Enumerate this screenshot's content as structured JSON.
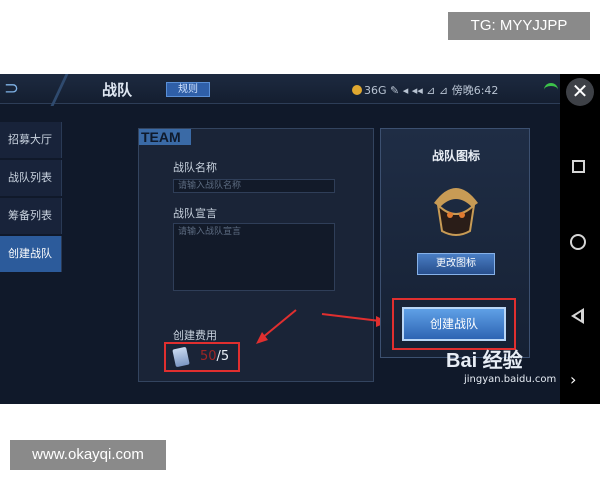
{
  "watermarks": {
    "top": "TG: MYYJJPP",
    "bottom": "www.okayqi.com"
  },
  "header": {
    "title": "战队",
    "tab": "规则",
    "status": "36G ✎ ◂ ◂◂ ⊿ ⊿ 傍晚6:42"
  },
  "sidebar": {
    "items": [
      {
        "label": "招募大厅",
        "active": false
      },
      {
        "label": "战队列表",
        "active": false
      },
      {
        "label": "筹备列表",
        "active": false
      },
      {
        "label": "创建战队",
        "active": true
      }
    ]
  },
  "form": {
    "tag": "TEAM",
    "name_label": "战队名称",
    "name_placeholder": "请输入战队名称",
    "motto_label": "战队宣言",
    "motto_placeholder": "请输入战队宣言",
    "cost_label": "创建费用",
    "cost_have": "50",
    "cost_need": "/5"
  },
  "emblem_panel": {
    "title": "战队图标",
    "change_label": "更改图标"
  },
  "create_button": {
    "label": "创建战队"
  },
  "watermark_baidu": {
    "logo": "Bai 经验",
    "url": "jingyan.baidu.com"
  },
  "colors": {
    "accent": "#2c5b9b",
    "highlight": "#e02f2f",
    "background": "#10192a"
  }
}
